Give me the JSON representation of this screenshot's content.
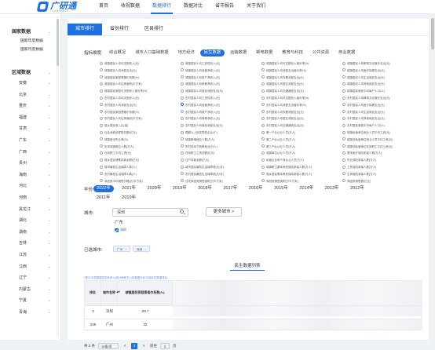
{
  "header": {
    "logo_text": "广研通",
    "logo_sub": "广东省城市数据平台",
    "nav": [
      {
        "label": "首页",
        "active": false
      },
      {
        "label": "收视数据",
        "active": false
      },
      {
        "label": "数据排行",
        "active": true
      },
      {
        "label": "数据对比",
        "active": false
      },
      {
        "label": "省市报告",
        "active": false
      },
      {
        "label": "关于我们",
        "active": false
      }
    ]
  },
  "sidebar": {
    "national_title": "国家数据",
    "national_items": [
      "国家年度数据",
      "国家月度数据"
    ],
    "region_title": "区域数据",
    "provinces": [
      "安徽",
      "北京",
      "重庆",
      "福建",
      "甘肃",
      "广东",
      "广西",
      "贵州",
      "海南",
      "河北",
      "河南",
      "黑龙江",
      "湖北",
      "湖南",
      "吉林",
      "江苏",
      "江西",
      "辽宁",
      "内蒙古",
      "宁夏",
      "青海"
    ]
  },
  "main": {
    "tabs": [
      {
        "label": "城市排行",
        "active": true
      },
      {
        "label": "省份排行",
        "active": false
      },
      {
        "label": "区县排行",
        "active": false
      }
    ],
    "dimension_label": "指标维度:",
    "dimensions": [
      {
        "label": "综合概况",
        "active": false
      },
      {
        "label": "城市人口基础数据",
        "active": false
      },
      {
        "label": "地方经济",
        "active": false
      },
      {
        "label": "民生数据",
        "active": true
      },
      {
        "label": "运输数据",
        "active": false
      },
      {
        "label": "邮电数据",
        "active": false
      },
      {
        "label": "教育与科技",
        "active": false
      },
      {
        "label": "公共资源",
        "active": false
      },
      {
        "label": "商业数据",
        "active": false
      }
    ],
    "indicator_columns": [
      [
        "城镇居民人均可支配收入(元)",
        "城镇居民人均消费支出(元)",
        "城镇居民家庭恩格尔系数(%)",
        "城镇居民人均住房面积(平方米)",
        "城镇居民家庭可支配收入增长率(%)",
        "农村居民人均可支配收入(元)",
        "农村居民人均消费支出(元)",
        "农村居民家庭恩格尔系数(%)",
        "农村居民人均住房面积(平方米)",
        "城乡居民收入比(倍)",
        "社会消费品零售总额(亿元)",
        "城镇登记失业率(%)",
        "年末城镇就业人数(万人)",
        "在岗职工平均工资(元)",
        "城乡居民储蓄存款余额(亿元)",
        "城市最低生活保障人数(人)",
        "农村最低生活保障人数(人)",
        "商品房平均销售价格(元/平方米)"
      ],
      [
        "城镇居民人均工资性收入(元)",
        "城镇居民人均经营净收入(元)",
        "城镇居民人均财产净收入(元)",
        "城镇居民人均转移净收入(元)",
        "城镇居民人均食品消费支出(元)",
        "农村居民人均工资性收入(元)",
        "农村居民人均经营净收入(元)",
        "农村居民人均财产净收入(元)",
        "农村居民人均转移净收入(元)",
        "农村居民人均食品消费支出(元)",
        "限额以上批发零售企业(个)",
        "城镇新增就业人数(万人)",
        "农村劳动力转移就业(万人)",
        "在岗职工工资总额(亿元)",
        "住户存款余额(亿元)",
        "城市居民最低生活保障线(元/月)",
        "农村居民最低生活保障线(元/月)",
        "住宅商品房销售面积(万平方米)"
      ],
      [
        "城镇居民人均可支配收入增长率(%)",
        "城镇居民人均消费支出增长率(%)",
        "城镇居民人均衣着消费支出(元)",
        "城镇居民人均居住消费支出(元)",
        "城镇居民人均交通通信支出(元)",
        "农村居民人均可支配收入增长率(%)",
        "农村居民人均消费支出增长率(%)",
        "农村居民人均衣着消费支出(元)",
        "农村居民人均居住消费支出(元)",
        "农村居民人均交通通信支出(元)",
        "第一产业从业人员(万人)",
        "第二产业从业人员(万人)",
        "第三产业从业人员(万人)",
        "城镇单位从业人员(万人)",
        "私营企业和个体从业人员(万人)",
        "城镇职工基本养老保险参保人数(万人)",
        "城乡居民基本养老保险参保人数(万人)",
        "商品房销售面积(万平方米)"
      ],
      [
        "城镇居民人均教育文化娱乐支出(元)",
        "城镇居民人均医疗保健支出(元)",
        "城镇居民人均生活用品支出(元)",
        "城镇居民人均其他用品支出(元)",
        "城镇居民家庭平均每户人口(人)",
        "农村居民人均教育文化娱乐支出(元)",
        "农村居民人均医疗保健支出(元)",
        "农村居民人均生活用品支出(元)",
        "农村居民人均其他用品支出(元)",
        "农村居民家庭平均每户人口(人)",
        "城镇私营单位就业人员平均工资(元)",
        "城镇非私营单位就业人员平均工资(元)",
        "城镇非私营单位在岗职工平均工资(元)",
        "基本医疗保险参保人数(万人)",
        "失业保险参保人数(万人)",
        "工伤保险参保人数(万人)",
        "生育保险参保人数(万人)",
        "商品房销售额(亿元)"
      ]
    ],
    "selected_indicator": {
      "col": 1,
      "row": 6
    },
    "year_label": "年份:",
    "years_row1": [
      "2022年",
      "2021年",
      "2020年",
      "2019年",
      "2018年",
      "2017年",
      "2016年",
      "2015年",
      "2014年",
      "2013年",
      "2012年"
    ],
    "years_row2": [
      "2011年",
      "2010年"
    ],
    "active_year": "2022年",
    "city_label": "城市:",
    "city_input_value": "深圳",
    "more_cities_label": "更多城市 >",
    "province_option": "广东",
    "checkbox_label": "深圳",
    "selected_cities_label": "已选城市:",
    "selected_cities": [
      "广州",
      "深圳"
    ],
    "list_title": "民生数据列表",
    "note": "*提示:本表数据仅供参考,以统计局官方公布数据为准,可能存在数据滞后。",
    "table": {
      "headers": [
        "排名",
        "城市名称",
        "城镇居民家庭恩格尔系数(%)"
      ],
      "rows": [
        {
          "rank": "3",
          "city": "深圳",
          "value": "29.7"
        },
        {
          "rank": "249",
          "city": "广州",
          "value": "32"
        }
      ]
    },
    "pager": {
      "total": "共 2 条",
      "page_size": "10条/页",
      "prev": "<",
      "current": "1",
      "next": ">",
      "goto_label": "前往",
      "goto_value": "1",
      "page_suffix": "页"
    }
  },
  "colors": {
    "accent": "#1e6fe0"
  }
}
